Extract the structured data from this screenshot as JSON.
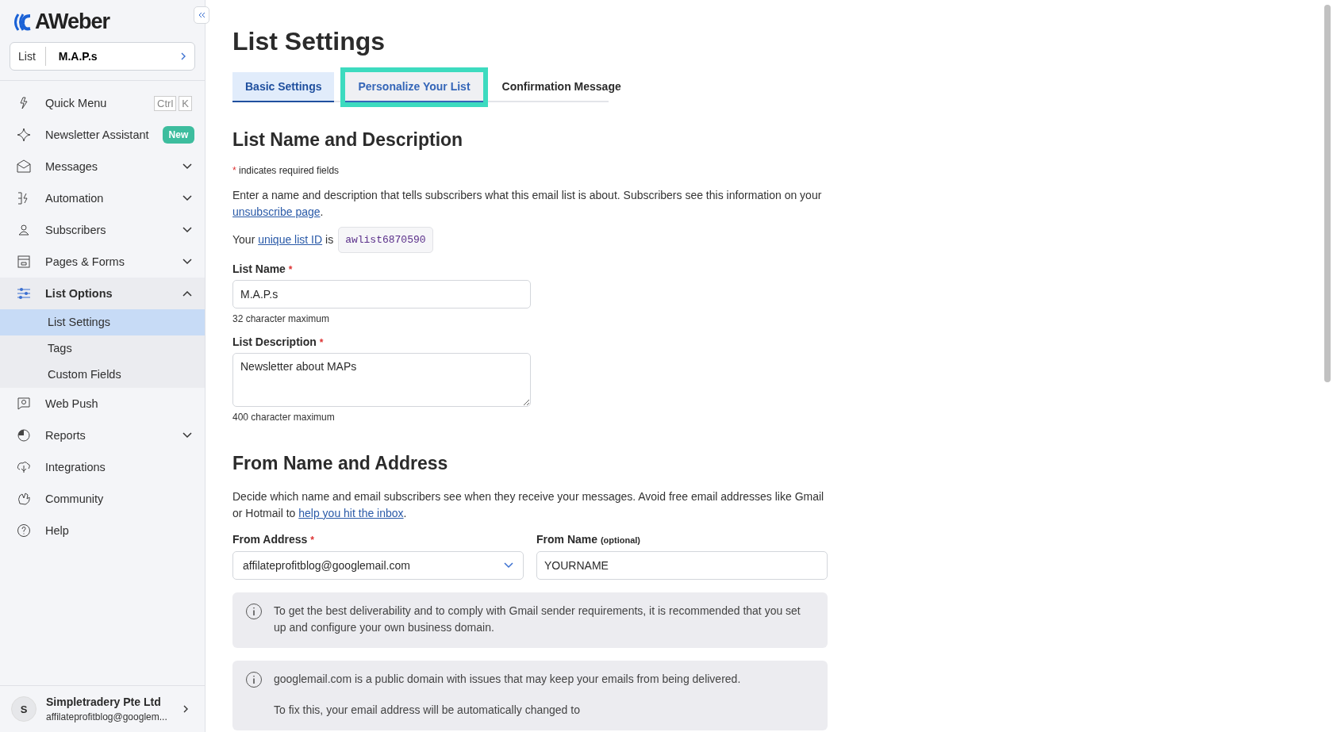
{
  "sidebar": {
    "logo": "AWeber",
    "list_picker": {
      "label": "List",
      "value": "M.A.P.s"
    },
    "items": [
      {
        "kind": "shortcut",
        "label": "Quick Menu",
        "keys": [
          "Ctrl",
          "K"
        ]
      },
      {
        "kind": "badge",
        "label": "Newsletter Assistant",
        "badge": "New"
      },
      {
        "kind": "group",
        "label": "Messages",
        "expanded": false
      },
      {
        "kind": "group",
        "label": "Automation",
        "expanded": false
      },
      {
        "kind": "group",
        "label": "Subscribers",
        "expanded": false
      },
      {
        "kind": "group",
        "label": "Pages & Forms",
        "expanded": false
      },
      {
        "kind": "group",
        "label": "List Options",
        "expanded": true,
        "children": [
          {
            "label": "List Settings",
            "selected": true
          },
          {
            "label": "Tags",
            "selected": false
          },
          {
            "label": "Custom Fields",
            "selected": false
          }
        ]
      },
      {
        "kind": "link",
        "label": "Web Push"
      },
      {
        "kind": "group",
        "label": "Reports",
        "expanded": false
      },
      {
        "kind": "link",
        "label": "Integrations"
      },
      {
        "kind": "link",
        "label": "Community"
      },
      {
        "kind": "link",
        "label": "Help"
      }
    ],
    "account": {
      "initial": "S",
      "name": "Simpletradery Pte Ltd",
      "email": "affilateprofitblog@googlem..."
    }
  },
  "page": {
    "title": "List Settings",
    "tabs": [
      {
        "label": "Basic Settings",
        "selected": true,
        "highlighted": false
      },
      {
        "label": "Personalize Your List",
        "selected": false,
        "highlighted": true
      },
      {
        "label": "Confirmation Message",
        "selected": false,
        "highlighted": false
      }
    ],
    "section_1": {
      "heading": "List Name and Description",
      "required_mark": "*",
      "required_note": "indicates required fields",
      "intro": "Enter a name and description that tells subscribers what this email list is about. Subscribers see this information on your ",
      "intro_link": "unsubscribe page",
      "intro_end": ".",
      "id_prefix": "Your ",
      "id_link": "unique list ID",
      "id_mid": " is",
      "list_id": "awlist6870590",
      "name_label": "List Name",
      "name_value": "M.A.P.s",
      "name_hint": "32 character maximum",
      "desc_label": "List Description",
      "desc_value": "Newsletter about MAPs",
      "desc_hint": "400 character maximum"
    },
    "section_2": {
      "heading": "From Name and Address",
      "intro": "Decide which name and email subscribers see when they receive your messages. Avoid free email addresses like Gmail or Hotmail to ",
      "intro_link": "help you hit the inbox",
      "intro_end": ".",
      "address_label": "From Address",
      "address_value": "affilateprofitblog@googlemail.com",
      "name_label": "From Name",
      "name_optional": "(optional)",
      "name_value": "YOURNAME",
      "notices": [
        {
          "lines": [
            "To get the best deliverability and to comply with Gmail sender requirements, it is recommended that you set up and configure your own business domain."
          ]
        },
        {
          "lines": [
            "googlemail.com is a public domain with issues that may keep your emails from being delivered.",
            "To fix this, your email address will be automatically changed to"
          ]
        }
      ]
    }
  }
}
